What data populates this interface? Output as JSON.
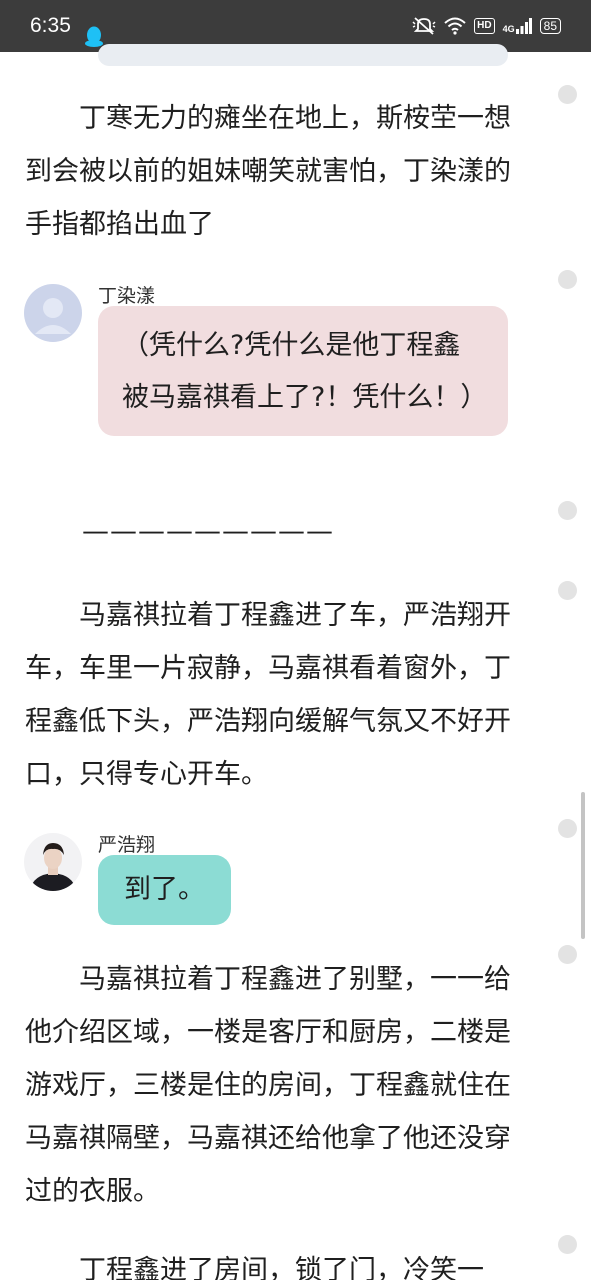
{
  "status_bar": {
    "time": "6:35",
    "hd": "HD",
    "network": "4G",
    "battery": "85"
  },
  "paragraphs": [
    "丁寒无力的瘫坐在地上，斯桉�europe一想到会被以前的姐妹嘲笑就害怕，丁染漾的手指都掐出血了",
    "马嘉祺拉着丁程鑫进了车，严浩翔开车，车里一片寂静，马嘉祺看着窗外，丁程鑫低下头，严浩翔向缓解气氛又不好开口，只得专心开车。",
    "马嘉祺拉着丁程鑫进了别墅，一一给他介绍区域，一楼是客厅和厨房，二楼是游戏厅，三楼是住的房间，丁程鑫就住在马嘉祺隔壁，马嘉祺还给他拿了他还没穿过的衣服。",
    "丁程鑫进了房间，锁了门，冷笑一"
  ],
  "dialogs": [
    {
      "speaker": "丁染漾",
      "text": "（凭什么?凭什么是他丁程鑫被马嘉祺看上了?！凭什么！）"
    },
    {
      "speaker": "严浩翔",
      "text": "到了。"
    }
  ],
  "divider": "—————————"
}
